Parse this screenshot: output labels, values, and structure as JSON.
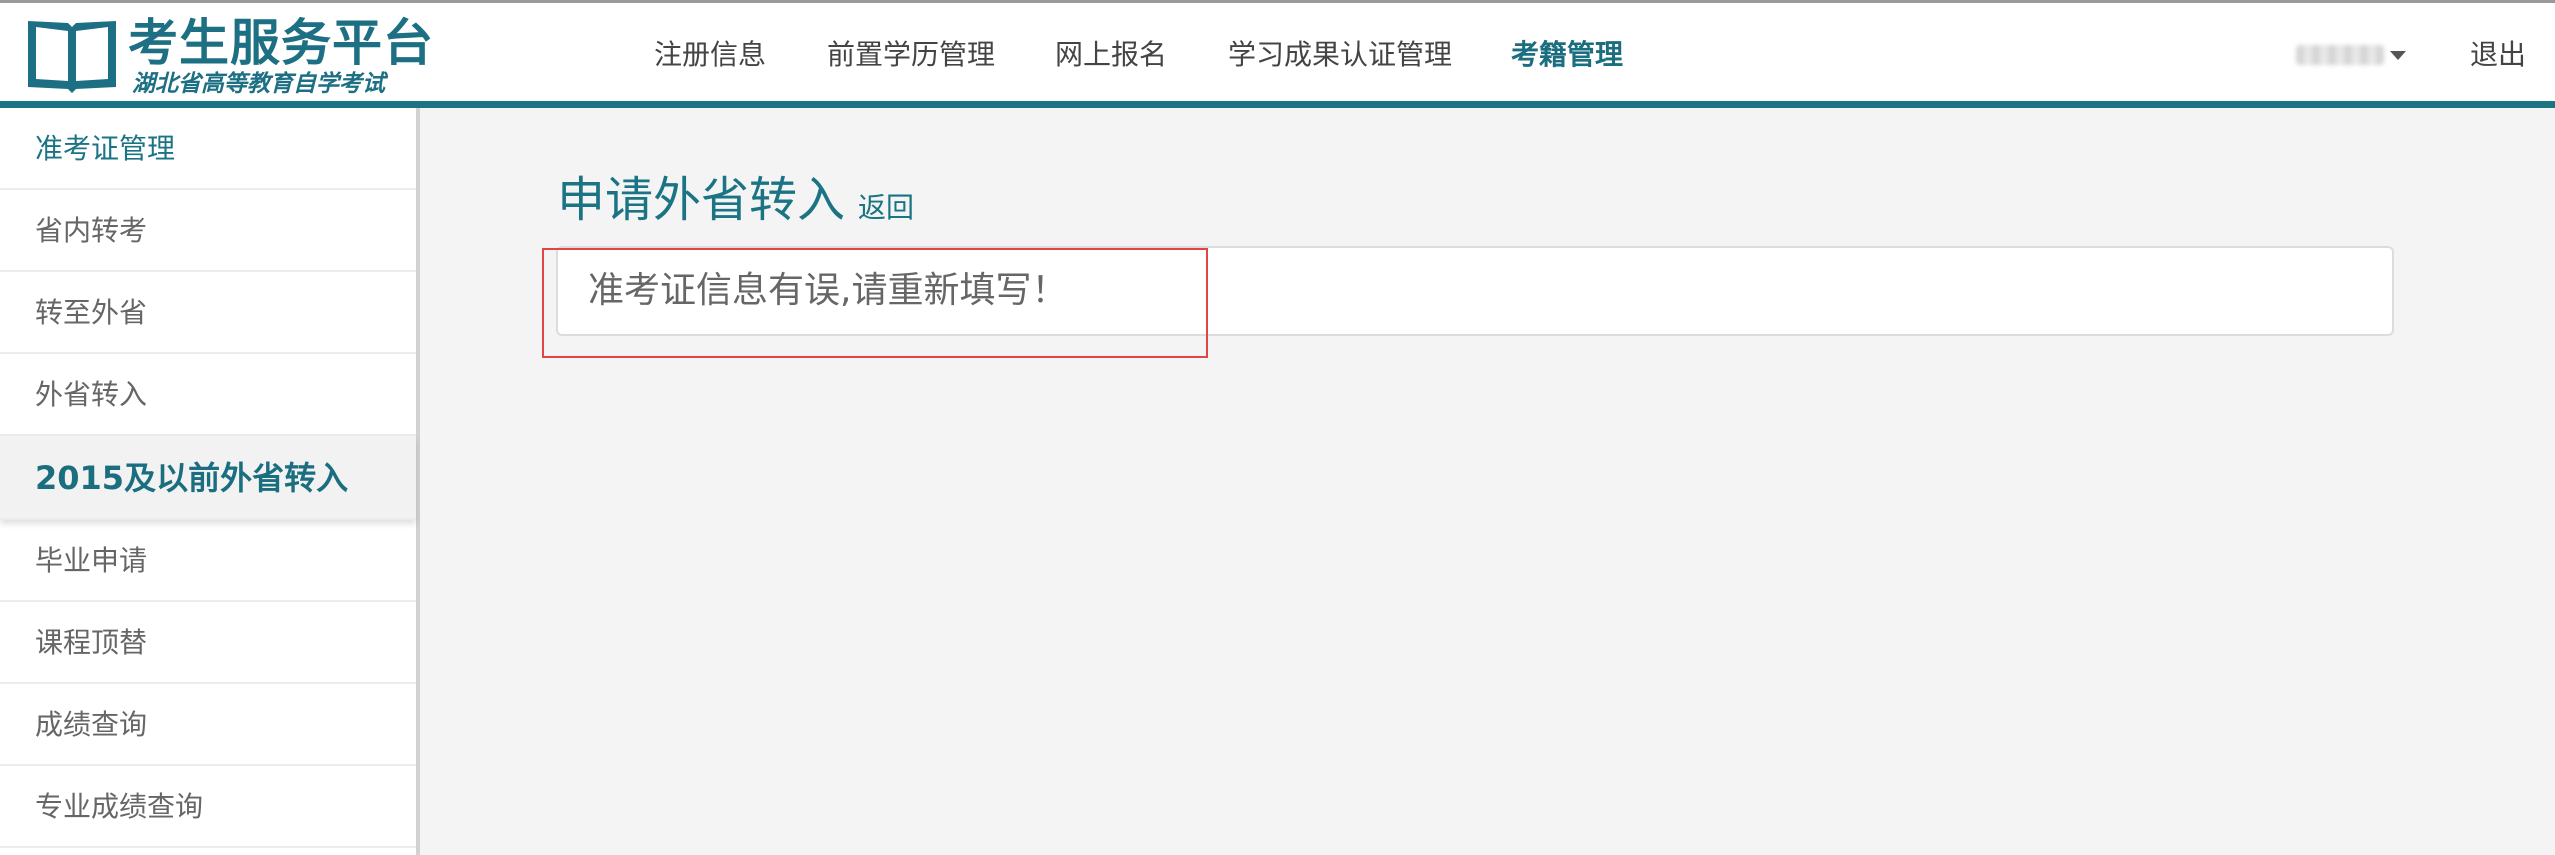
{
  "brand": {
    "title": "考生服务平台",
    "subtitle": "湖北省高等教育自学考试"
  },
  "colors": {
    "accent": "#1a7484",
    "highlight": "#e04646"
  },
  "nav": {
    "items": [
      {
        "label": "注册信息"
      },
      {
        "label": "前置学历管理"
      },
      {
        "label": "网上报名"
      },
      {
        "label": "学习成果认证管理"
      },
      {
        "label": "考籍管理",
        "active": true
      }
    ]
  },
  "user": {
    "dropdown_icon": "caret-down-icon",
    "logout": "退出"
  },
  "sidebar": {
    "items": [
      {
        "label": "准考证管理"
      },
      {
        "label": "省内转考"
      },
      {
        "label": "转至外省"
      },
      {
        "label": "外省转入"
      },
      {
        "label": "2015及以前外省转入",
        "selected": true
      },
      {
        "label": "毕业申请"
      },
      {
        "label": "课程顶替"
      },
      {
        "label": "成绩查询"
      },
      {
        "label": "专业成绩查询"
      }
    ]
  },
  "main": {
    "title": "申请外省转入",
    "back": "返回",
    "alert": "准考证信息有误,请重新填写！"
  }
}
